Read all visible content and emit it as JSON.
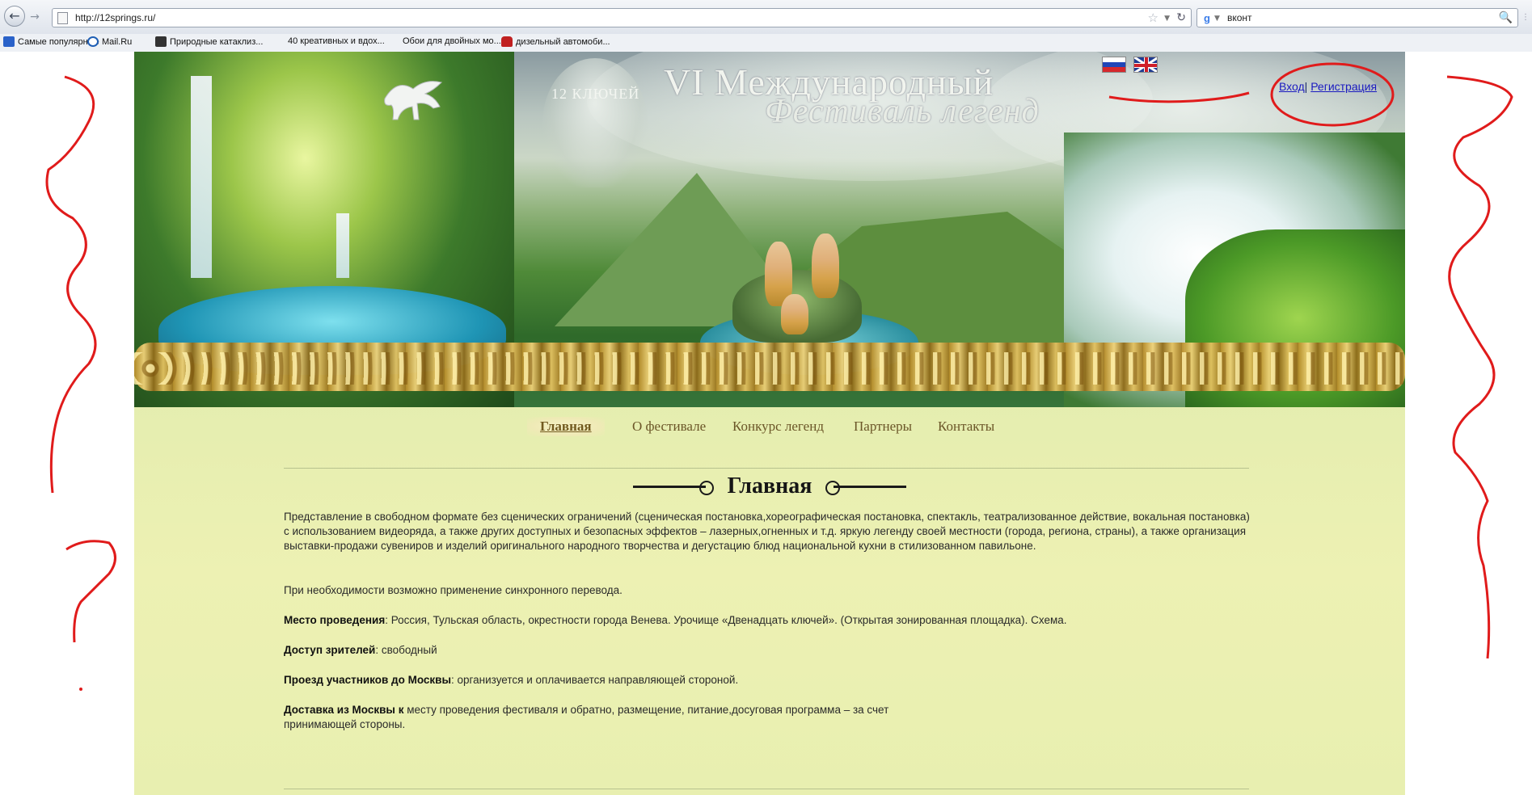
{
  "browser": {
    "url": "http://12springs.ru/",
    "search_text": "вконт",
    "search_engine": "google-icon",
    "bookmarks": [
      {
        "label": "Самые популярные",
        "icon": "firefox-bookmark-icon",
        "color": "#2a62c9"
      },
      {
        "label": "Mail.Ru",
        "icon": "mail-ru-icon",
        "color": "#1f5fb5"
      },
      {
        "label": "Природные катаклиз...",
        "icon": "km-site-icon",
        "color": "#333333"
      },
      {
        "label": "40 креативных и вдох...",
        "icon": "",
        "color": ""
      },
      {
        "label": "Обои для двойных мо...",
        "icon": "",
        "color": ""
      },
      {
        "label": "дизельный автомоби...",
        "icon": "car-icon",
        "color": "#c02020"
      }
    ]
  },
  "site": {
    "emblem_text": "12 КЛЮЧЕЙ",
    "title_line1": "VI Международный",
    "title_line2": "Фестиваль легенд",
    "languages": [
      {
        "code": "ru",
        "icon": "russia-flag-icon"
      },
      {
        "code": "en",
        "icon": "uk-flag-icon"
      }
    ],
    "auth": {
      "login": "Вход",
      "separator": "|",
      "register": "Регистрация"
    },
    "menu": [
      {
        "label": "Главная",
        "active": true
      },
      {
        "label": "О фестивале",
        "active": false
      },
      {
        "label": "Конкурс легенд",
        "active": false
      },
      {
        "label": "Партнеры",
        "active": false
      },
      {
        "label": "Контакты",
        "active": false
      }
    ],
    "page_heading": "Главная",
    "paragraphs": {
      "intro": "Представление в свободном формате без сценических ограничений (сценическая постановка,хореографическая постановка, спектакль, театрализованное действие, вокальная постановка) с использованием видеоряда, а также других доступных и безопасных эффектов – лазерных,огненных и т.д. яркую легенду своей местности (города, региона, страны), а также организация выставки-продажи сувениров и изделий оригинального народного творчества и дегустацию блюд национальной кухни в стилизованном павильоне.",
      "translation": "При необходимости возможно применение синхронного перевода.",
      "venue_label": "Место проведения",
      "venue_text": ": Россия, Тульская область, окрестности города Венева. Урочище «Двенадцать ключей». (Открытая зонированная площадка). Схема.",
      "access_label": "Доступ зрителей",
      "access_text": ": свободный",
      "travel_label": "Проезд участников до Москвы",
      "travel_text": ": организуется и оплачивается направляющей стороной.",
      "delivery_label": "Доставка из Москвы к",
      "delivery_text": " месту проведения фестиваля и обратно, размещение, питание,досуговая программа – за счет",
      "delivery_text2": "принимающей стороны."
    }
  },
  "colors": {
    "annotation_red": "#e01b1b",
    "link_blue": "#1a1ac0",
    "menu_brown": "#6b5628"
  }
}
